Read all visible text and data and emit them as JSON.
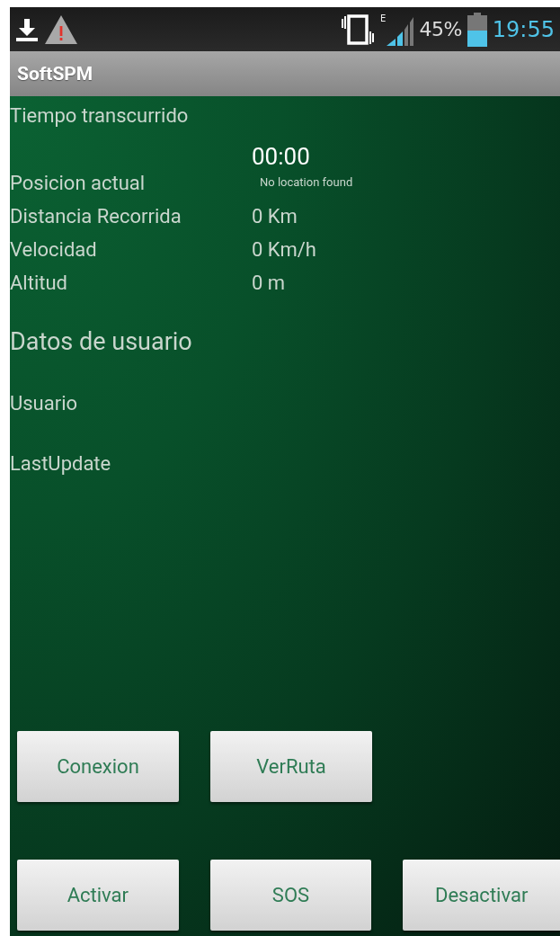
{
  "status_bar": {
    "network": "E",
    "battery": "45%",
    "time": "19:55"
  },
  "app_bar": {
    "title": "SoftSPM"
  },
  "elapsed": {
    "label": "Tiempo transcurrido",
    "value": "00:00"
  },
  "fields": [
    {
      "label": "Posicion actual",
      "value": "No location found",
      "kind": "small"
    },
    {
      "label": "Distancia Recorrida",
      "value": "0 Km",
      "kind": "normal"
    },
    {
      "label": "Velocidad",
      "value": "0 Km/h",
      "kind": "normal"
    },
    {
      "label": "Altitud",
      "value": "0 m",
      "kind": "normal"
    }
  ],
  "user_section": {
    "title": "Datos de usuario",
    "items": [
      "Usuario",
      "LastUpdate"
    ]
  },
  "button_rows": [
    [
      "Conexion",
      "VerRuta"
    ],
    [
      "Activar",
      "SOS",
      "Desactivar"
    ]
  ]
}
